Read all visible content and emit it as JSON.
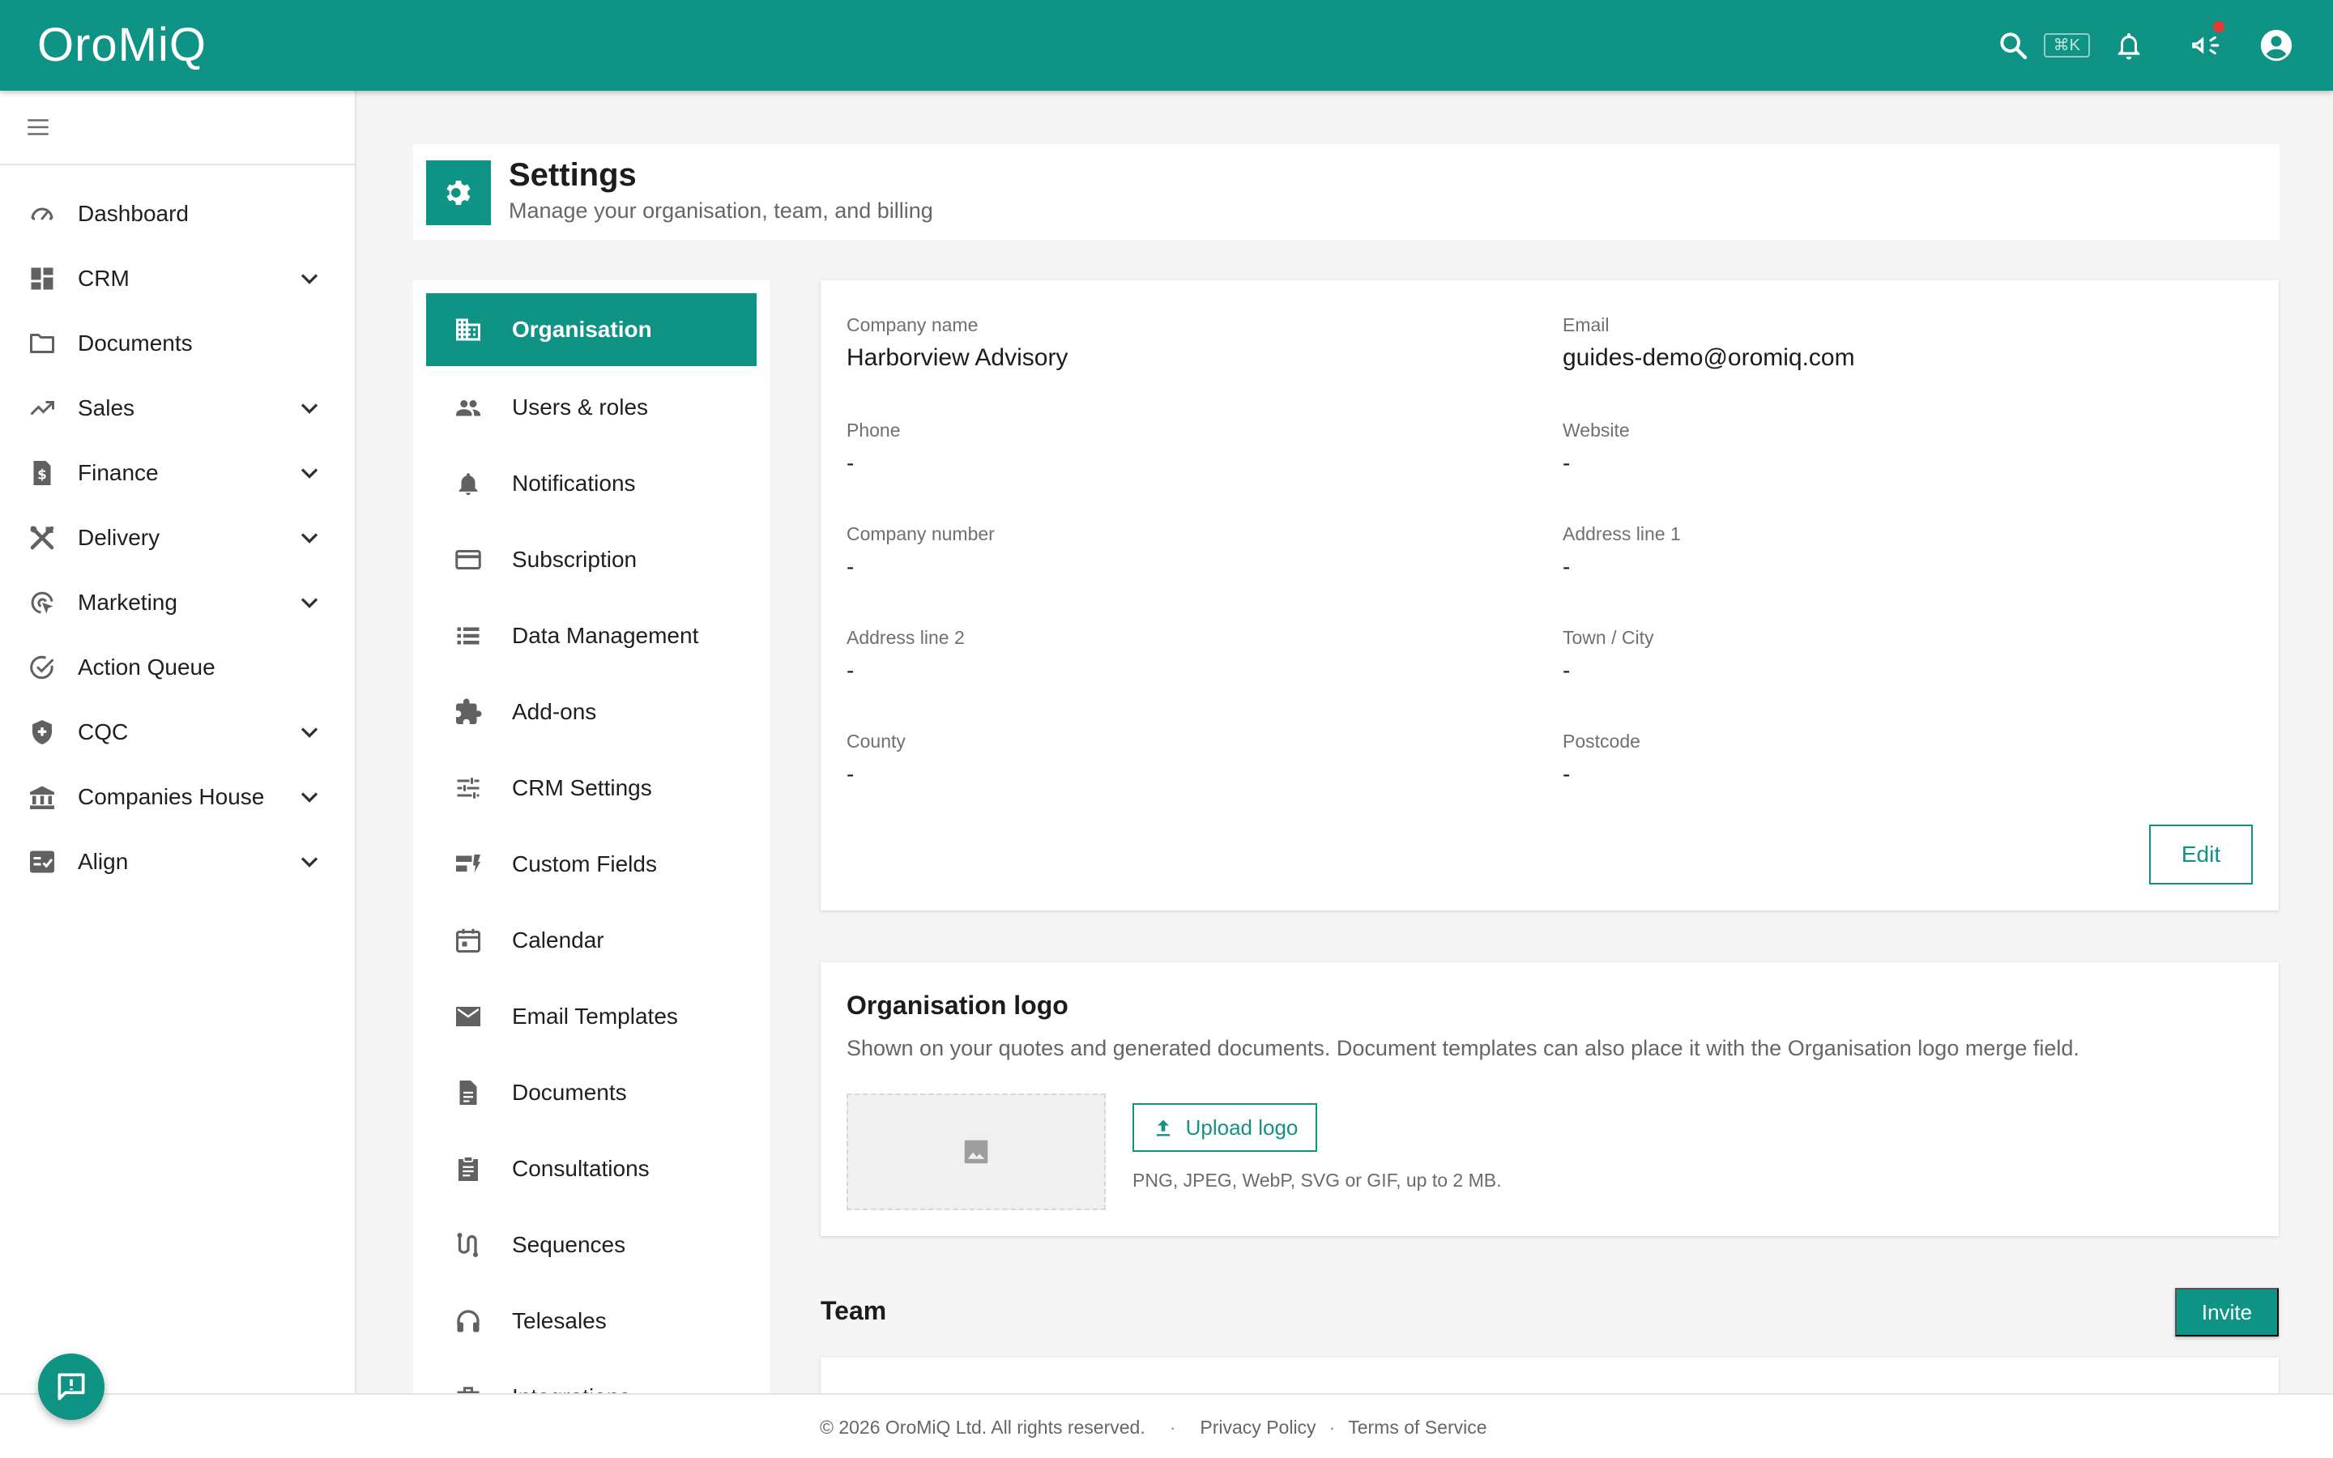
{
  "app": {
    "brand": "OroMiQ",
    "shortcut_hint": "⌘K"
  },
  "colors": {
    "primary": "#0e9384",
    "notification_dot": "#e53935"
  },
  "sidebar": {
    "items": [
      {
        "label": "Dashboard",
        "icon": "speedometer-icon"
      },
      {
        "label": "CRM",
        "icon": "dashboard-grid-icon"
      },
      {
        "label": "Documents",
        "icon": "folder-icon"
      },
      {
        "label": "Sales",
        "icon": "trending-up-icon"
      },
      {
        "label": "Finance",
        "icon": "invoice-icon"
      },
      {
        "label": "Delivery",
        "icon": "tools-icon"
      },
      {
        "label": "Marketing",
        "icon": "target-cursor-icon"
      },
      {
        "label": "Action Queue",
        "icon": "check-circle-icon"
      },
      {
        "label": "CQC",
        "icon": "shield-plus-icon"
      },
      {
        "label": "Companies House",
        "icon": "bank-icon"
      },
      {
        "label": "Align",
        "icon": "checklist-icon"
      }
    ]
  },
  "page": {
    "title": "Settings",
    "subtitle": "Manage your organisation, team, and billing"
  },
  "settings_nav": {
    "items": [
      {
        "label": "Organisation",
        "icon": "building-icon"
      },
      {
        "label": "Users & roles",
        "icon": "people-icon"
      },
      {
        "label": "Notifications",
        "icon": "bell-icon"
      },
      {
        "label": "Subscription",
        "icon": "credit-card-icon"
      },
      {
        "label": "Data Management",
        "icon": "list-icon"
      },
      {
        "label": "Add-ons",
        "icon": "puzzle-icon"
      },
      {
        "label": "CRM Settings",
        "icon": "sliders-icon"
      },
      {
        "label": "Custom Fields",
        "icon": "dynamic-form-icon"
      },
      {
        "label": "Calendar",
        "icon": "calendar-icon"
      },
      {
        "label": "Email Templates",
        "icon": "envelope-icon"
      },
      {
        "label": "Documents",
        "icon": "document-icon"
      },
      {
        "label": "Consultations",
        "icon": "clipboard-icon"
      },
      {
        "label": "Sequences",
        "icon": "route-icon"
      },
      {
        "label": "Telesales",
        "icon": "headset-icon"
      },
      {
        "label": "Integrations",
        "icon": "briefcase-icon"
      }
    ]
  },
  "organisation": {
    "fields": {
      "company_name": {
        "label": "Company name",
        "value": "Harborview Advisory"
      },
      "email": {
        "label": "Email",
        "value": "guides-demo@oromiq.com"
      },
      "phone": {
        "label": "Phone",
        "value": "-"
      },
      "website": {
        "label": "Website",
        "value": "-"
      },
      "company_number": {
        "label": "Company number",
        "value": "-"
      },
      "address_line_1": {
        "label": "Address line 1",
        "value": "-"
      },
      "address_line_2": {
        "label": "Address line 2",
        "value": "-"
      },
      "town_city": {
        "label": "Town / City",
        "value": "-"
      },
      "county": {
        "label": "County",
        "value": "-"
      },
      "postcode": {
        "label": "Postcode",
        "value": "-"
      }
    },
    "edit_label": "Edit"
  },
  "logo_section": {
    "title": "Organisation logo",
    "description": "Shown on your quotes and generated documents. Document templates can also place it with the Organisation logo merge field.",
    "upload_label": "Upload logo",
    "hint": "PNG, JPEG, WebP, SVG or GIF, up to 2 MB."
  },
  "team": {
    "title": "Team",
    "invite_label": "Invite"
  },
  "footer": {
    "copyright": "© 2026 OroMiQ Ltd. All rights reserved.",
    "separator": "·",
    "privacy": "Privacy Policy",
    "terms": "Terms of Service"
  }
}
